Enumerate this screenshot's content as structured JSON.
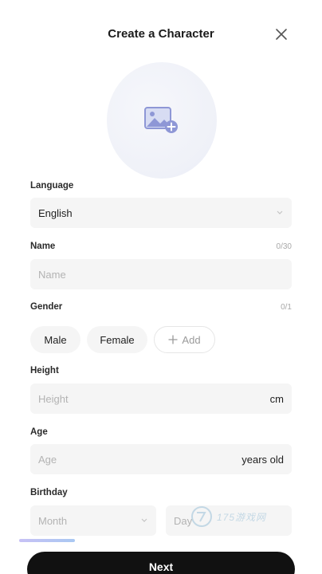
{
  "header": {
    "title": "Create a Character"
  },
  "icons": {
    "close": "close-icon",
    "avatar": "image-add-icon",
    "dropdown": "chevron-down-icon",
    "add": "plus-icon"
  },
  "colors": {
    "button_bg": "#111111",
    "field_bg": "#f5f5f5",
    "progress_start": "#c7c1f5",
    "progress_end": "#a9c8f2"
  },
  "language": {
    "label": "Language",
    "value": "English"
  },
  "name": {
    "label": "Name",
    "counter": "0/30",
    "placeholder": "Name"
  },
  "gender": {
    "label": "Gender",
    "counter": "0/1",
    "options": [
      "Male",
      "Female"
    ],
    "add_label": "Add"
  },
  "height": {
    "label": "Height",
    "placeholder": "Height",
    "unit": "cm"
  },
  "age": {
    "label": "Age",
    "placeholder": "Age",
    "unit": "years old"
  },
  "birthday": {
    "label": "Birthday",
    "month_placeholder": "Month",
    "day_placeholder": "Day"
  },
  "progress": {
    "fraction": 0.18
  },
  "footer": {
    "next_label": "Next"
  },
  "watermark": {
    "text": "175游戏网"
  }
}
